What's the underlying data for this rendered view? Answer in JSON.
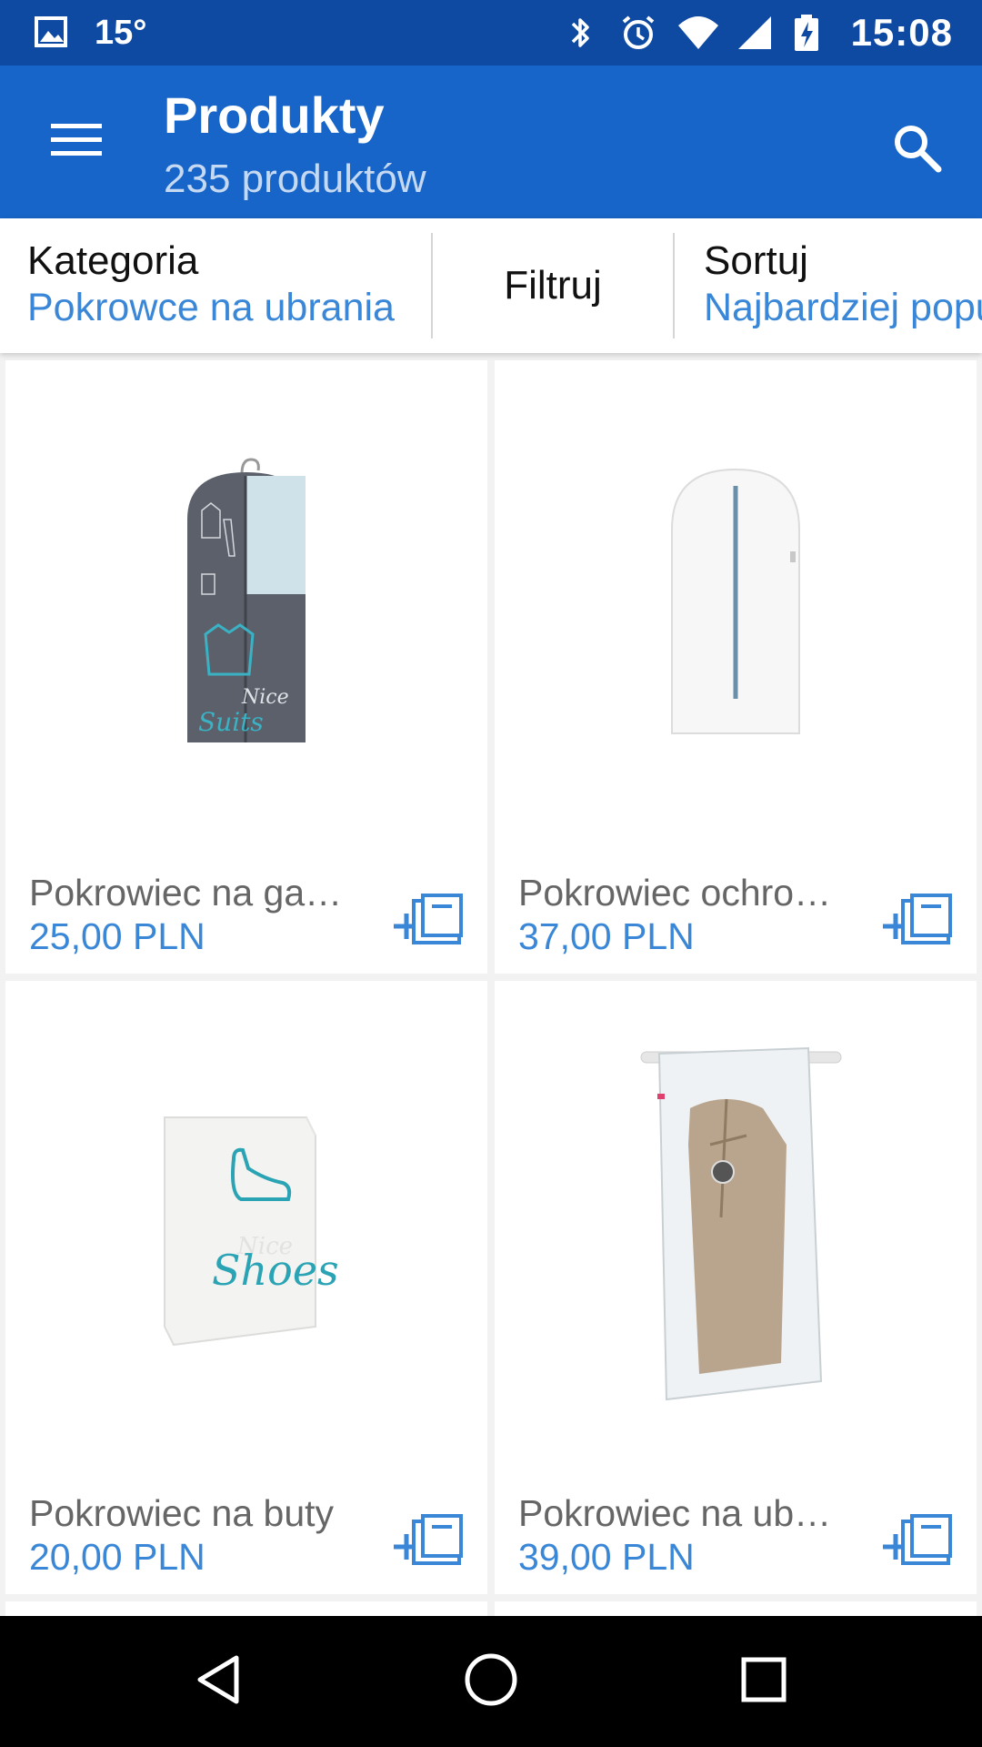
{
  "status_bar": {
    "temperature": "15°",
    "time": "15:08",
    "icons": [
      "image-icon",
      "bluetooth-icon",
      "alarm-icon",
      "wifi-icon",
      "signal-icon",
      "battery-charging-icon"
    ]
  },
  "app_bar": {
    "title": "Produkty",
    "subtitle": "235 produktów",
    "icons": [
      "menu-icon",
      "search-icon"
    ]
  },
  "filters": {
    "category_label": "Kategoria",
    "category_value": "Pokrowce na ubrania",
    "filter_label": "Filtruj",
    "sort_label": "Sortuj",
    "sort_value": "Najbardziej popularne"
  },
  "products": [
    {
      "name": "Pokrowiec na garnitur",
      "price": "25,00 PLN",
      "image_text_1": "Nice",
      "image_text_2": "Suits"
    },
    {
      "name": "Pokrowiec ochronny",
      "price": "37,00 PLN"
    },
    {
      "name": "Pokrowiec na buty",
      "price": "20,00 PLN",
      "image_text_1": "Nice",
      "image_text_2": "Shoes"
    },
    {
      "name": "Pokrowiec na ubrania",
      "price": "39,00 PLN"
    }
  ],
  "colors": {
    "status_bar": "#0f4aa2",
    "app_bar": "#1765c8",
    "accent": "#3a87d8"
  },
  "nav_bar": {
    "icons": [
      "back-icon",
      "home-icon",
      "recents-icon"
    ]
  }
}
